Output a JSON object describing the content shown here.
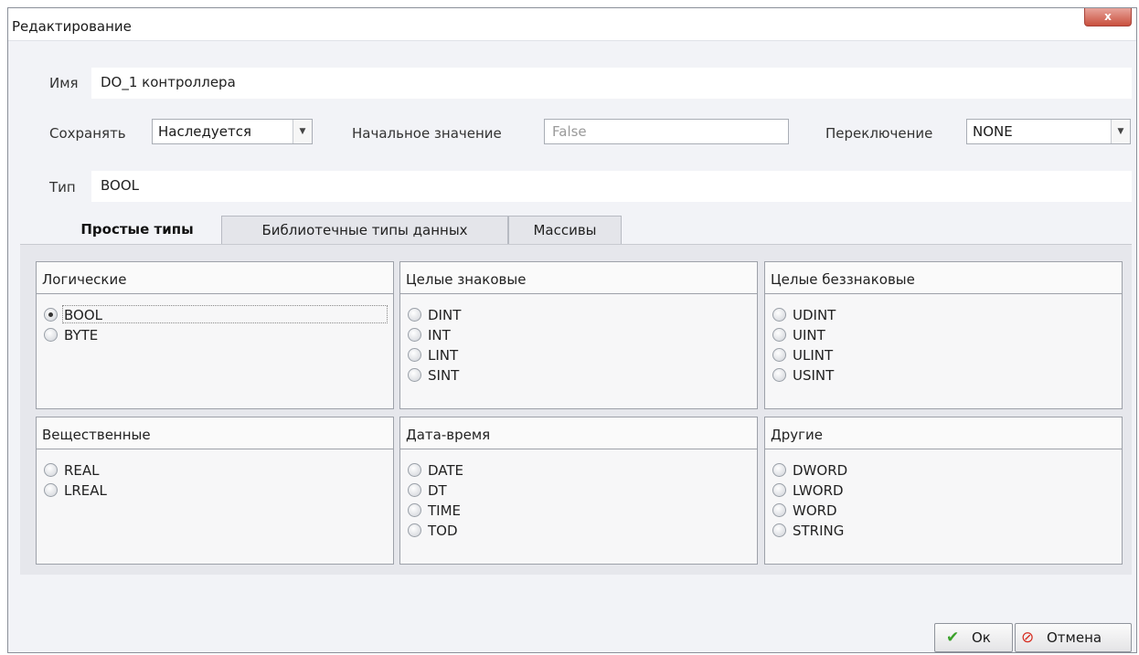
{
  "window": {
    "title": "Редактирование",
    "close_glyph": "x"
  },
  "fields": {
    "name_label": "Имя",
    "name_value": "DO_1 контроллера",
    "save_label": "Сохранять",
    "save_value": "Наследуется",
    "initial_label": "Начальное значение",
    "initial_placeholder": "False",
    "switch_label": "Переключение",
    "switch_value": "NONE",
    "type_label": "Тип",
    "type_value": "BOOL"
  },
  "tabs": [
    {
      "label": "Простые типы",
      "active": true
    },
    {
      "label": "Библиотечные типы данных",
      "active": false
    },
    {
      "label": "Массивы",
      "active": false
    }
  ],
  "groups": [
    {
      "title": "Логические",
      "options": [
        "BOOL",
        "BYTE"
      ],
      "selected": "BOOL"
    },
    {
      "title": "Целые знаковые",
      "options": [
        "DINT",
        "INT",
        "LINT",
        "SINT"
      ]
    },
    {
      "title": "Целые беззнаковые",
      "options": [
        "UDINT",
        "UINT",
        "ULINT",
        "USINT"
      ]
    },
    {
      "title": "Вещественные",
      "options": [
        "REAL",
        "LREAL"
      ]
    },
    {
      "title": "Дата-время",
      "options": [
        "DATE",
        "DT",
        "TIME",
        "TOD"
      ]
    },
    {
      "title": "Другие",
      "options": [
        "DWORD",
        "LWORD",
        "WORD",
        "STRING"
      ]
    }
  ],
  "buttons": {
    "ok_label": "Ок",
    "cancel_label": "Отмена"
  },
  "colors": {
    "ok_icon": "#3aa12a",
    "cancel_icon": "#d62b1f",
    "close_button": "#c9503e"
  }
}
